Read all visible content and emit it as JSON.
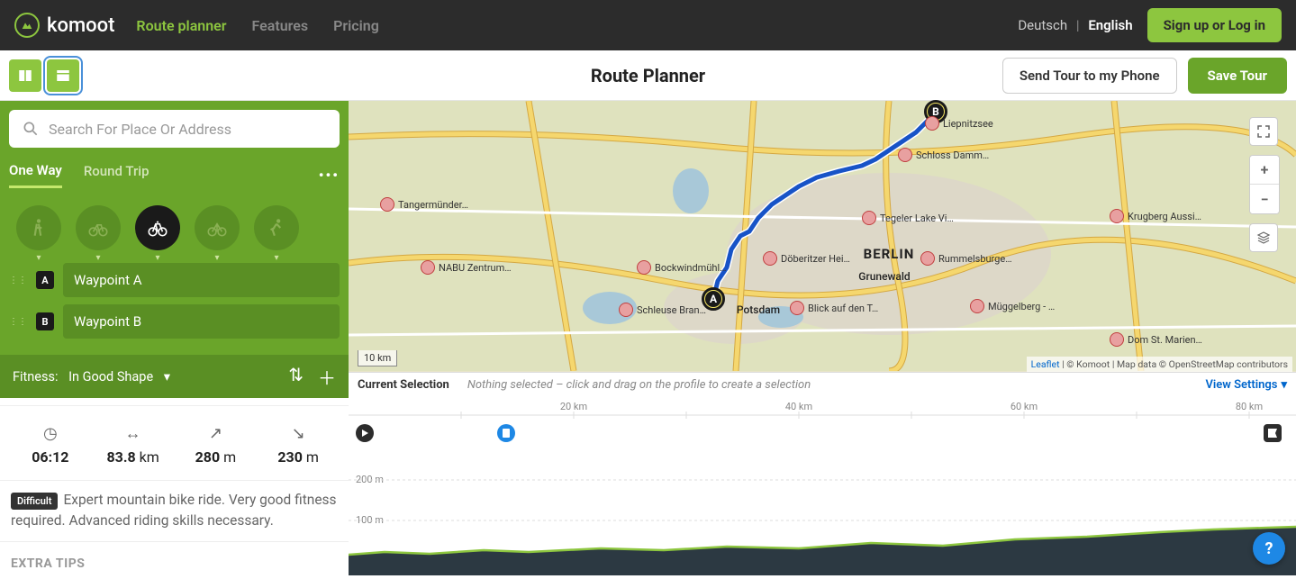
{
  "header": {
    "brand": "komoot",
    "nav": {
      "planner": "Route planner",
      "features": "Features",
      "pricing": "Pricing"
    },
    "lang": {
      "de": "Deutsch",
      "en": "English"
    },
    "signup": "Sign up or Log in"
  },
  "subhead": {
    "title": "Route Planner",
    "send": "Send Tour to my Phone",
    "save": "Save Tour"
  },
  "sidebar": {
    "search_placeholder": "Search For Place Or Address",
    "tabs": {
      "oneway": "One Way",
      "round": "Round Trip"
    },
    "waypoints": {
      "a_marker": "A",
      "a_value": "Waypoint A",
      "b_marker": "B",
      "b_value": "Waypoint B"
    },
    "fitness": {
      "label": "Fitness:",
      "value": "In Good Shape"
    },
    "stats": {
      "duration": "06:12",
      "distance_val": "83.8",
      "distance_unit": "km",
      "up_val": "280",
      "up_unit": "m",
      "down_val": "230",
      "down_unit": "m"
    },
    "difficulty_badge": "Difficult",
    "description": "Expert mountain bike ride. Very good fitness required. Advanced riding skills necessary.",
    "extra": "EXTRA TIPS"
  },
  "map": {
    "scale": "10 km",
    "attribution": {
      "leaflet": "Leaflet",
      "komoot": "© Komoot",
      "osm": "Map data © OpenStreetMap contributors"
    },
    "cities": {
      "berlin": "BERLIN",
      "potsdam": "Potsdam",
      "grunewald": "Grunewald"
    },
    "pois": {
      "liepnitzsee": "Liepnitzsee",
      "schloss": "Schloss Damm…",
      "tegeler": "Tegeler Lake Vi…",
      "rummel": "Rummelsburge…",
      "muggel": "Müggelberg - …",
      "krugberg": "Krugberg Aussi…",
      "marien": "Dom St. Marien…",
      "doberitz": "Döberitzer Hei…",
      "blick": "Blick auf den T…",
      "bockwind": "Bockwindmühl…",
      "schleuse": "Schleuse Bran…",
      "nabu": "NABU Zentrum…",
      "tanger": "Tangermünder…"
    },
    "markers": {
      "a": "A",
      "b": "B"
    }
  },
  "profile": {
    "label": "Current Selection",
    "hint": "Nothing selected – click and drag on the profile to create a selection",
    "settings": "View Settings",
    "ticks": {
      "d20": "20 km",
      "d40": "40 km",
      "d60": "60 km",
      "d80": "80 km"
    },
    "yticks": {
      "y100": "100 m",
      "y200": "200 m"
    }
  },
  "help": "?"
}
